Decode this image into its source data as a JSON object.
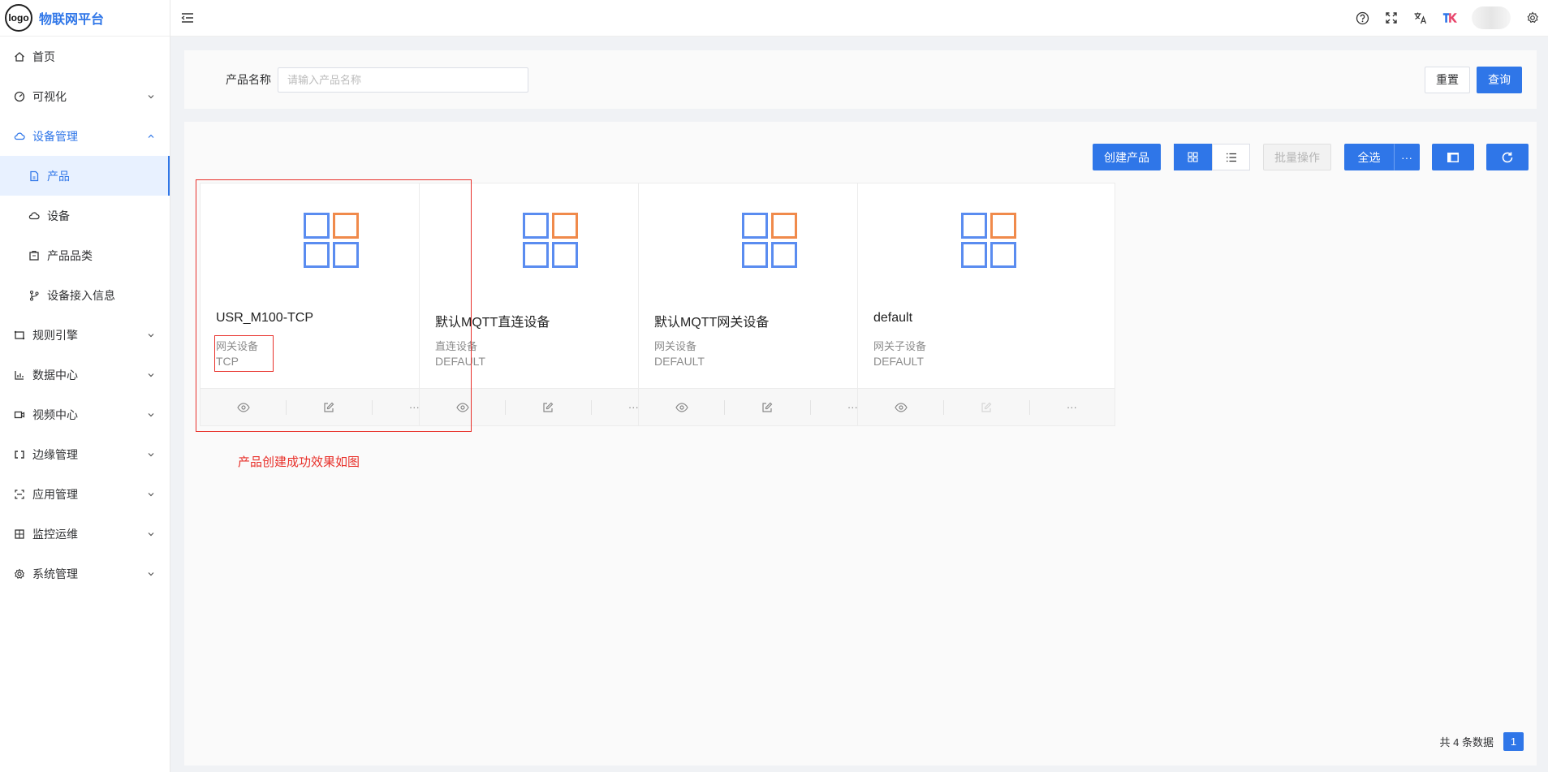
{
  "app": {
    "logo_text": "logo",
    "title": "物联网平台"
  },
  "sidebar": {
    "items": [
      {
        "label": "首页",
        "icon": "home-icon"
      },
      {
        "label": "可视化",
        "icon": "dashboard-icon"
      },
      {
        "label": "设备管理",
        "icon": "device-cloud-icon"
      },
      {
        "label": "产品",
        "icon": "product-doc-icon"
      },
      {
        "label": "设备",
        "icon": "device-icon"
      },
      {
        "label": "产品品类",
        "icon": "category-icon"
      },
      {
        "label": "设备接入信息",
        "icon": "branch-icon"
      },
      {
        "label": "规则引擎",
        "icon": "rule-icon"
      },
      {
        "label": "数据中心",
        "icon": "chart-icon"
      },
      {
        "label": "视频中心",
        "icon": "video-icon"
      },
      {
        "label": "边缘管理",
        "icon": "edge-icon"
      },
      {
        "label": "应用管理",
        "icon": "app-icon"
      },
      {
        "label": "监控运维",
        "icon": "monitor-icon"
      },
      {
        "label": "系统管理",
        "icon": "settings-icon"
      }
    ]
  },
  "topbar": {
    "icons": [
      "help-icon",
      "fullscreen-icon",
      "translate-icon",
      "brand-tk-icon",
      "avatar",
      "gear-icon"
    ]
  },
  "search": {
    "label": "产品名称",
    "placeholder": "请输入产品名称",
    "value": "",
    "reset_label": "重置",
    "query_label": "查询"
  },
  "toolbar": {
    "create_label": "创建产品",
    "batch_label": "批量操作",
    "select_all_label": "全选",
    "more_label": "···"
  },
  "cards": [
    {
      "title": "USR_M100-TCP",
      "type": "网关设备",
      "protocol": "TCP"
    },
    {
      "title": "默认MQTT直连设备",
      "type": "直连设备",
      "protocol": "DEFAULT"
    },
    {
      "title": "默认MQTT网关设备",
      "type": "网关设备",
      "protocol": "DEFAULT"
    },
    {
      "title": "default",
      "type": "网关子设备",
      "protocol": "DEFAULT"
    }
  ],
  "card_more_label": "···",
  "annotation": "产品创建成功效果如图",
  "pagination": {
    "total_text": "共 4 条数据",
    "current_page": "1"
  },
  "colors": {
    "primary": "#2f76e8",
    "annotation_red": "#e8302a",
    "icon_blue": "#5a8cf0",
    "icon_orange": "#f08a4b"
  }
}
